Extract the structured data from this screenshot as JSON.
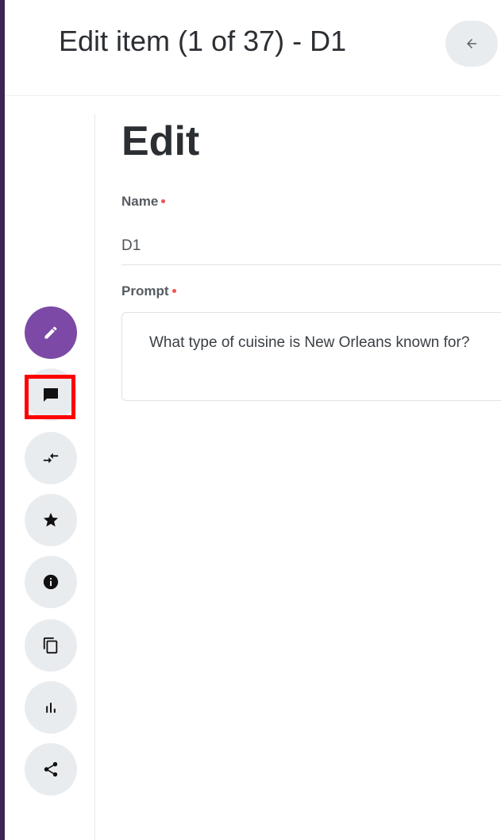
{
  "header": {
    "title": "Edit item (1 of 37) - D1",
    "back_icon": "arrow-left-icon"
  },
  "rail": {
    "items": [
      {
        "name": "edit",
        "icon": "pencil-icon",
        "active": true
      },
      {
        "name": "comments",
        "icon": "chat-bubble-icon",
        "active": false,
        "highlighted": true
      },
      {
        "name": "compare",
        "icon": "compare-arrows-icon",
        "active": false
      },
      {
        "name": "favorite",
        "icon": "star-icon",
        "active": false
      },
      {
        "name": "info",
        "icon": "info-icon",
        "active": false
      },
      {
        "name": "duplicate",
        "icon": "copy-icon",
        "active": false
      },
      {
        "name": "stats",
        "icon": "bar-chart-icon",
        "active": false
      },
      {
        "name": "share",
        "icon": "share-icon",
        "active": false
      }
    ]
  },
  "main": {
    "section_title": "Edit",
    "name_label": "Name",
    "name_value": "D1",
    "prompt_label": "Prompt",
    "prompt_value": "What type of cuisine is New Orleans known for?"
  },
  "colors": {
    "accent": "#7c4aa6",
    "highlight": "#ff0000",
    "required": "#ef5350",
    "frame": "#3c2553"
  }
}
